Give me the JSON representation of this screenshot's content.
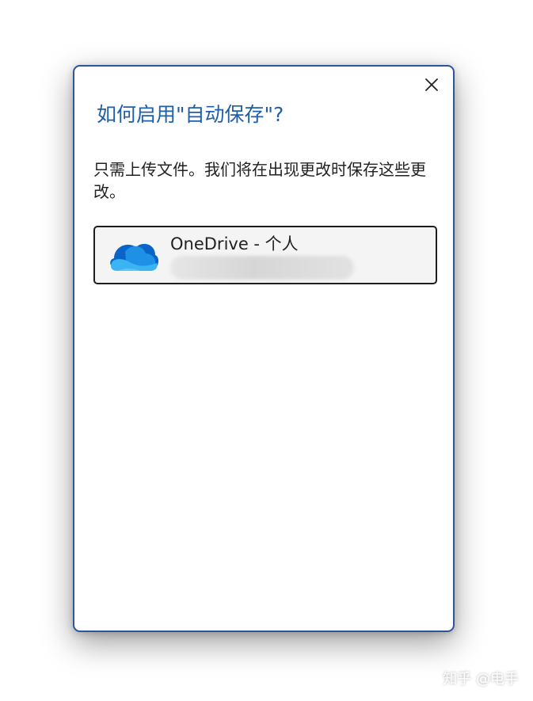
{
  "dialog": {
    "title": "如何启用\"自动保存\"?",
    "description": "只需上传文件。我们将在出现更改时保存这些更改。",
    "close_icon": "close-icon"
  },
  "account": {
    "name": "OneDrive - 个人",
    "icon": "onedrive-cloud-icon"
  },
  "watermark": {
    "text": "知乎 @电手"
  },
  "colors": {
    "title": "#1f5fa8",
    "dialog_border": "#2b5797",
    "account_border": "#1e1e1e",
    "account_background": "#f4f4f4"
  }
}
